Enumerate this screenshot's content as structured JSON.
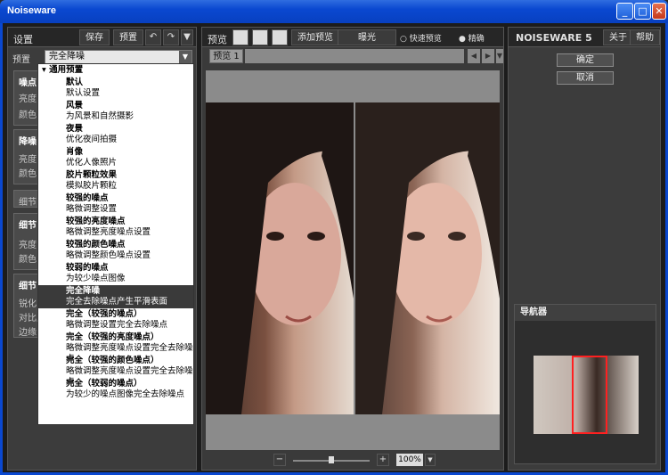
{
  "window": {
    "title": "Noiseware",
    "minimize": "_",
    "maximize": "□",
    "close": "✕"
  },
  "left": {
    "header": {
      "settings": "设置",
      "save": "保存",
      "preview": "预置"
    },
    "preset": {
      "label": "预置",
      "value": "完全降噪"
    },
    "sections": {
      "noise_level": {
        "title": "噪点",
        "items": [
          "亮度",
          "颜色"
        ]
      },
      "denoise": {
        "title": "降噪",
        "items": [
          "亮度",
          "颜色"
        ]
      },
      "detail_tab": "细节",
      "detail": {
        "title": "细节",
        "items": [
          "亮度",
          "颜色"
        ]
      },
      "enhance": {
        "title": "细节",
        "items": [
          "锐化",
          "对比度",
          "边缘"
        ]
      }
    },
    "dropdown": {
      "group": "通用预置",
      "items": [
        {
          "title": "默认",
          "desc": "默认设置"
        },
        {
          "title": "风景",
          "desc": "为风景和自然摄影"
        },
        {
          "title": "夜景",
          "desc": "优化夜间拍摄"
        },
        {
          "title": "肖像",
          "desc": "优化人像照片"
        },
        {
          "title": "胶片颗粒效果",
          "desc": "模拟胶片颗粒"
        },
        {
          "title": "较强的噪点",
          "desc": "略微调整设置"
        },
        {
          "title": "较强的亮度噪点",
          "desc": "略微调整亮度噪点设置"
        },
        {
          "title": "较强的颜色噪点",
          "desc": "略微调整颜色噪点设置"
        },
        {
          "title": "较弱的噪点",
          "desc": "为较少噪点图像"
        },
        {
          "title": "完全降噪",
          "desc": "完全去除噪点产生平滑表面"
        },
        {
          "title": "完全（较强的噪点）",
          "desc": "略微调整设置完全去除噪点"
        },
        {
          "title": "完全（较强的亮度噪点）",
          "desc": "略微调整亮度噪点设置完全去除噪点"
        },
        {
          "title": "完全（较强的颜色噪点）",
          "desc": "略微调整亮度噪点设置完全去除噪点"
        },
        {
          "title": "完全（较弱的噪点）",
          "desc": "为较少的噪点图像完全去除噪点"
        }
      ]
    }
  },
  "center": {
    "header": {
      "preview": "预览",
      "add_preview": "添加预览",
      "exposure": "曝光",
      "quick_preview": "快速预览",
      "precise": "精确"
    },
    "tab": "预览 1",
    "zoom": {
      "minus": "−",
      "plus": "+",
      "value": "100%"
    }
  },
  "right": {
    "brand_left": "NOISEWARE",
    "brand_num": "5",
    "about": "关于",
    "help": "帮助",
    "ok": "确定",
    "cancel": "取消",
    "navigator": "导航器"
  }
}
